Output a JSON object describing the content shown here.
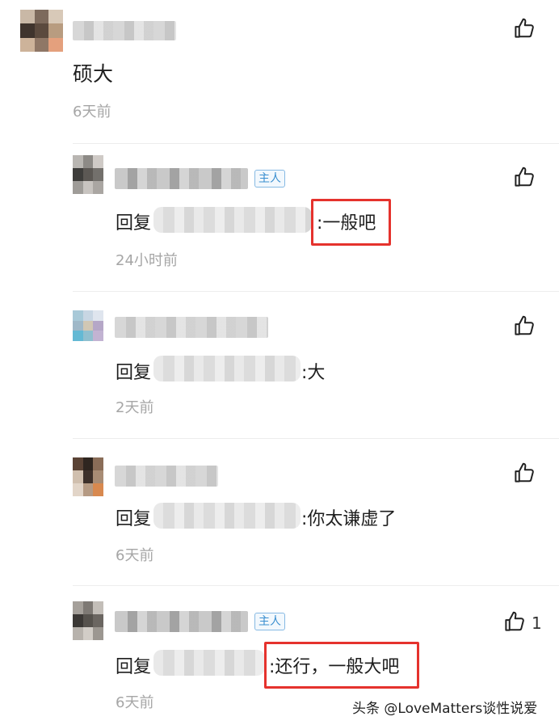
{
  "comment": {
    "text": "硕大",
    "time": "6天前"
  },
  "replies": [
    {
      "prefix": "回复",
      "text": ":一般吧",
      "time": "24小时前",
      "badge": "主人",
      "likes": ""
    },
    {
      "prefix": "回复",
      "text": ":大",
      "time": "2天前",
      "badge": "",
      "likes": ""
    },
    {
      "prefix": "回复",
      "text": ":你太谦虚了",
      "time": "6天前",
      "badge": "",
      "likes": ""
    },
    {
      "prefix": "回复",
      "text": ":还行，一般大吧",
      "time": "6天前",
      "badge": "主人",
      "likes": "1"
    }
  ],
  "watermark": "头条 @LoveMatters谈性说爱",
  "colors": {
    "highlight": "#e5322d",
    "badge": "#3a8fd0",
    "time": "#a6a6a6"
  },
  "icons": [
    "thumbs-up-icon"
  ]
}
